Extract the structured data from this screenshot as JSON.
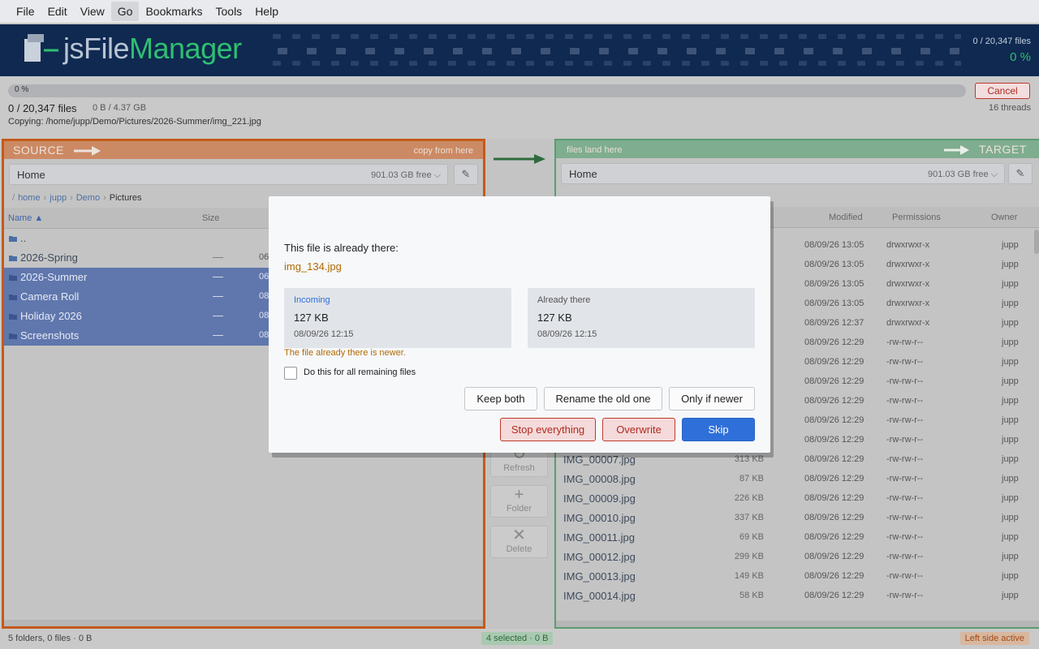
{
  "menu": [
    "File",
    "Edit",
    "View",
    "Go",
    "Bookmarks",
    "Tools",
    "Help"
  ],
  "banner": {
    "brand_a": "js",
    "brand_b": "File",
    "brand_c": "Manager",
    "filecount": "0 / 20,347  files",
    "percent": "0 %"
  },
  "progress": {
    "bar_label": "0 %",
    "bar_fraction": 0,
    "files": "0 / 20,347 files",
    "bytes": "0 B / 4.37 GB",
    "threads": "16 threads",
    "copying_label": "Copying:",
    "copying_path": "/home/jupp/Demo/Pictures/2026-Summer/img_221.jpg",
    "cancel": "Cancel"
  },
  "left": {
    "title": "SOURCE",
    "hint": "copy from here",
    "location": "Home",
    "free": "901.03 GB free",
    "crumbs": [
      "home",
      "jupp",
      "Demo"
    ],
    "crumb_current": "Pictures",
    "col_name": "Name ▲",
    "col_size": "Size",
    "rows": [
      {
        "name": "..",
        "size": "",
        "date": "",
        "selected": false
      },
      {
        "name": "2026-Spring",
        "size": "—",
        "date": "06",
        "selected": false
      },
      {
        "name": "2026-Summer",
        "size": "—",
        "date": "06",
        "selected": true
      },
      {
        "name": "Camera Roll",
        "size": "—",
        "date": "08",
        "selected": true
      },
      {
        "name": "Holiday 2026",
        "size": "—",
        "date": "08",
        "selected": true
      },
      {
        "name": "Screenshots",
        "size": "—",
        "date": "08",
        "selected": true
      }
    ]
  },
  "right": {
    "title": "TARGET",
    "hint": "files land here",
    "location": "Home",
    "free": "901.03 GB free",
    "col_modified": "Modified",
    "col_permissions": "Permissions",
    "col_owner": "Owner",
    "rows": [
      {
        "name": "",
        "size": "",
        "modified": "08/09/26 13:05",
        "perm": "drwxrwxr-x",
        "owner": "jupp"
      },
      {
        "name": "",
        "size": "",
        "modified": "08/09/26 13:05",
        "perm": "drwxrwxr-x",
        "owner": "jupp"
      },
      {
        "name": "",
        "size": "",
        "modified": "08/09/26 13:05",
        "perm": "drwxrwxr-x",
        "owner": "jupp"
      },
      {
        "name": "",
        "size": "",
        "modified": "08/09/26 13:05",
        "perm": "drwxrwxr-x",
        "owner": "jupp"
      },
      {
        "name": "",
        "size": "",
        "modified": "08/09/26 12:37",
        "perm": "drwxrwxr-x",
        "owner": "jupp"
      },
      {
        "name": "",
        "size": "",
        "modified": "08/09/26 12:29",
        "perm": "-rw-rw-r--",
        "owner": "jupp"
      },
      {
        "name": "",
        "size": "",
        "modified": "08/09/26 12:29",
        "perm": "-rw-rw-r--",
        "owner": "jupp"
      },
      {
        "name": "",
        "size": "",
        "modified": "08/09/26 12:29",
        "perm": "-rw-rw-r--",
        "owner": "jupp"
      },
      {
        "name": "",
        "size": "",
        "modified": "08/09/26 12:29",
        "perm": "-rw-rw-r--",
        "owner": "jupp"
      },
      {
        "name": "",
        "size": "",
        "modified": "08/09/26 12:29",
        "perm": "-rw-rw-r--",
        "owner": "jupp"
      },
      {
        "name": "",
        "size": "",
        "modified": "08/09/26 12:29",
        "perm": "-rw-rw-r--",
        "owner": "jupp"
      },
      {
        "name": "IMG_00007.jpg",
        "size": "313 KB",
        "modified": "08/09/26 12:29",
        "perm": "-rw-rw-r--",
        "owner": "jupp"
      },
      {
        "name": "IMG_00008.jpg",
        "size": "87 KB",
        "modified": "08/09/26 12:29",
        "perm": "-rw-rw-r--",
        "owner": "jupp"
      },
      {
        "name": "IMG_00009.jpg",
        "size": "226 KB",
        "modified": "08/09/26 12:29",
        "perm": "-rw-rw-r--",
        "owner": "jupp"
      },
      {
        "name": "IMG_00010.jpg",
        "size": "337 KB",
        "modified": "08/09/26 12:29",
        "perm": "-rw-rw-r--",
        "owner": "jupp"
      },
      {
        "name": "IMG_00011.jpg",
        "size": "69 KB",
        "modified": "08/09/26 12:29",
        "perm": "-rw-rw-r--",
        "owner": "jupp"
      },
      {
        "name": "IMG_00012.jpg",
        "size": "299 KB",
        "modified": "08/09/26 12:29",
        "perm": "-rw-rw-r--",
        "owner": "jupp"
      },
      {
        "name": "IMG_00013.jpg",
        "size": "149 KB",
        "modified": "08/09/26 12:29",
        "perm": "-rw-rw-r--",
        "owner": "jupp"
      },
      {
        "name": "IMG_00014.jpg",
        "size": "58 KB",
        "modified": "08/09/26 12:29",
        "perm": "-rw-rw-r--",
        "owner": "jupp"
      }
    ]
  },
  "tools": {
    "refresh": "Refresh",
    "folder": "Folder",
    "delete": "Delete"
  },
  "status": {
    "left": "5 folders, 0 files  ·  0 B",
    "center": "4 selected  ·  0 B",
    "right": "Left side active"
  },
  "dialog": {
    "question": "This file is already there:",
    "filename": "img_134.jpg",
    "incoming_label": "Incoming",
    "incoming_size": "127 KB",
    "incoming_date": "08/09/26 12:15",
    "existing_label": "Already there",
    "existing_size": "127 KB",
    "existing_date": "08/09/26 12:15",
    "note": "The file already there is newer.",
    "checkbox_label": "Do this for all remaining files",
    "keep_both": "Keep both",
    "rename_old": "Rename the old one",
    "only_newer": "Only if newer",
    "stop": "Stop everything",
    "overwrite": "Overwrite",
    "skip": "Skip"
  },
  "colors": {
    "source_accent": "#c45a1a",
    "target_accent": "#5a9c72",
    "brand_green": "#2fbf71",
    "primary": "#2f6fd9",
    "danger": "#c0392b"
  }
}
